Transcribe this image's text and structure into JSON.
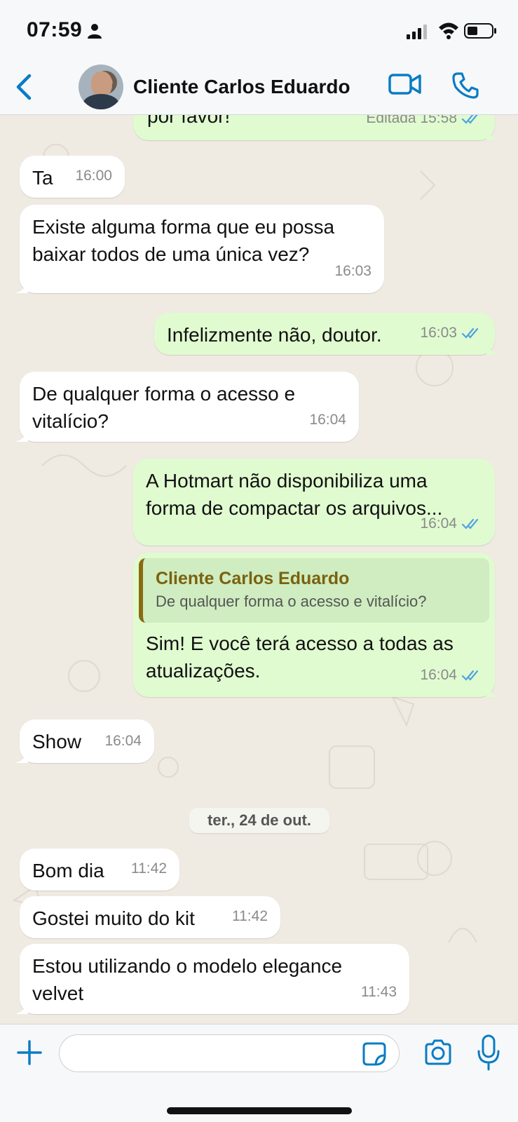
{
  "status_bar": {
    "time": "07:59"
  },
  "header": {
    "contact_name": "Cliente Carlos Eduardo"
  },
  "messages": [
    {
      "dir": "out",
      "text": "por favor!",
      "time": "Editada 15:58",
      "read": true
    },
    {
      "dir": "in",
      "text": "Ta",
      "time": "16:00"
    },
    {
      "dir": "in",
      "text": "Existe alguma forma que eu possa baixar todos de uma única vez?",
      "time": "16:03"
    },
    {
      "dir": "out",
      "text": "Infelizmente não, doutor.",
      "time": "16:03",
      "read": true
    },
    {
      "dir": "in",
      "text": "De qualquer forma o acesso e vitalício?",
      "time": "16:04"
    },
    {
      "dir": "out",
      "text": "A Hotmart não disponibiliza uma forma de compactar os arquivos...",
      "time": "16:04",
      "read": true
    },
    {
      "dir": "out",
      "quote": {
        "name": "Cliente Carlos Eduardo",
        "text": "De qualquer forma o acesso e vitalício?"
      },
      "text": "Sim! E você terá acesso a todas as atualizações.",
      "time": "16:04",
      "read": true
    },
    {
      "dir": "in",
      "text": "Show",
      "time": "16:04"
    },
    {
      "dir": "in",
      "text": "Bom dia",
      "time": "11:42"
    },
    {
      "dir": "in",
      "text": "Gostei muito do kit",
      "time": "11:42"
    },
    {
      "dir": "in",
      "text": "Estou utilizando o modelo elegance velvet",
      "time": "11:43"
    }
  ],
  "date_separator": "ter., 24 de out.",
  "composer": {
    "placeholder": ""
  },
  "colors": {
    "accent": "#0a7cc4",
    "outgoing_bubble": "#e0fbd0",
    "incoming_bubble": "#ffffff",
    "read_ticks": "#4fa3e0",
    "quote_name": "#7a6210"
  }
}
